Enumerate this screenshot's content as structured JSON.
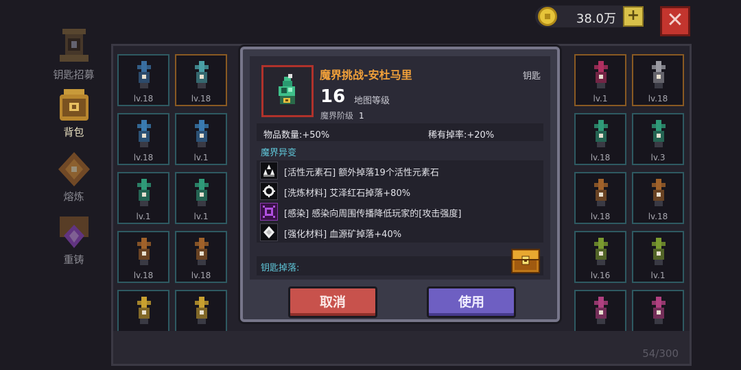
{
  "sidebar": {
    "items": [
      {
        "label": "钥匙招募",
        "icon": "key-altar-icon",
        "state": "dim"
      },
      {
        "label": "背包",
        "icon": "backpack-icon",
        "state": "active"
      },
      {
        "label": "熔炼",
        "icon": "smelt-icon",
        "state": "dim"
      },
      {
        "label": "重铸",
        "icon": "reforge-icon",
        "state": "dim"
      }
    ]
  },
  "topbar": {
    "coins": "38.0万",
    "plus": "+",
    "close": "✕"
  },
  "inventory": {
    "count": "54/300",
    "slots": [
      {
        "lvl": "lv.18",
        "color": "#3a6ea0",
        "frame": "teal"
      },
      {
        "lvl": "lv.18",
        "color": "#4aa0a6",
        "frame": "orange"
      },
      {
        "lvl": "lv.1",
        "color": "#b03060",
        "frame": "orange"
      },
      {
        "lvl": "lv.18",
        "color": "#9a9aa2",
        "frame": "orange"
      },
      {
        "lvl": "lv.18",
        "color": "#3a7ab0",
        "frame": "teal"
      },
      {
        "lvl": "lv.1",
        "color": "#3a7ab0",
        "frame": "teal"
      },
      {
        "lvl": "lv.18",
        "color": "#2f9a78",
        "frame": "teal"
      },
      {
        "lvl": "lv.3",
        "color": "#2f9a78",
        "frame": "teal"
      },
      {
        "lvl": "lv.1",
        "color": "#2f9a78",
        "frame": "teal"
      },
      {
        "lvl": "lv.1",
        "color": "#2f9a78",
        "frame": "teal"
      },
      {
        "lvl": "lv.18",
        "color": "#a0622a",
        "frame": "teal"
      },
      {
        "lvl": "lv.18",
        "color": "#a0622a",
        "frame": "teal"
      },
      {
        "lvl": "lv.18",
        "color": "#a0622a",
        "frame": "teal"
      },
      {
        "lvl": "lv.18",
        "color": "#a0622a",
        "frame": "teal"
      },
      {
        "lvl": "lv.16",
        "color": "#7a9a30",
        "frame": "teal"
      },
      {
        "lvl": "lv.1",
        "color": "#7a9a30",
        "frame": "teal"
      },
      {
        "lvl": "",
        "color": "#c8a030",
        "frame": "teal"
      },
      {
        "lvl": "",
        "color": "#c8a030",
        "frame": "teal"
      },
      {
        "lvl": "",
        "color": "#b04080",
        "frame": "teal"
      },
      {
        "lvl": "",
        "color": "#b04080",
        "frame": "teal"
      }
    ]
  },
  "modal": {
    "title": "魔界挑战-安杜马里",
    "type": "钥匙",
    "level": "16",
    "level_label": "地图等级",
    "tier_label": "魔界阶级",
    "tier_value": "1",
    "stat_quantity": "物品数量:+50%",
    "stat_rare": "稀有掉率:+20%",
    "section": "魔界异变",
    "mods": [
      {
        "text": "[活性元素石] 额外掉落19个活性元素石",
        "icon": "crystals-icon"
      },
      {
        "text": "[洗炼材料] 艾泽红石掉落+80%",
        "icon": "gear-icon"
      },
      {
        "text": "[感染] 感染向周围传播降低玩家的[攻击强度]",
        "icon": "infection-icon"
      },
      {
        "text": "[强化材料] 血源矿掉落+40%",
        "icon": "ore-icon"
      }
    ],
    "drop_label": "钥匙掉落:",
    "cancel": "取消",
    "use": "使用"
  }
}
